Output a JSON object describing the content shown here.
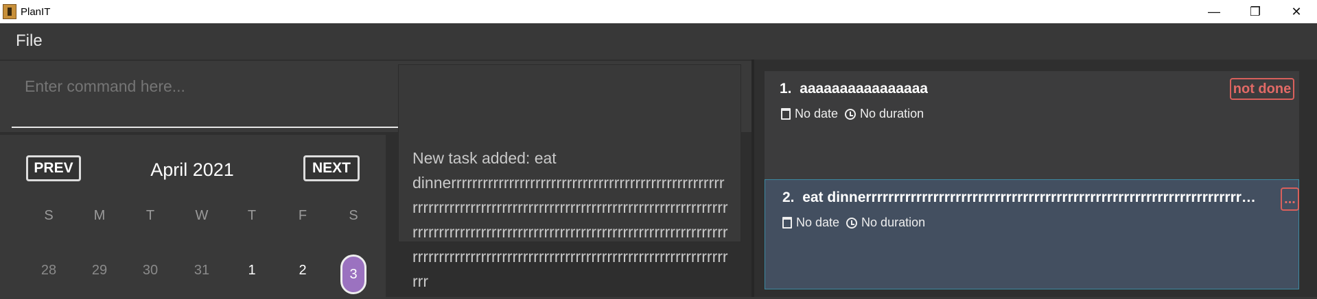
{
  "window": {
    "title": "PlanIT",
    "minimize": "—",
    "restore": "❐",
    "close": "✕"
  },
  "menu": {
    "file": "File"
  },
  "command": {
    "placeholder": "Enter command here...",
    "value": ""
  },
  "calendar": {
    "prev": "PREV",
    "next": "NEXT",
    "month": "April 2021",
    "weekdays": [
      "S",
      "M",
      "T",
      "W",
      "T",
      "F",
      "S"
    ],
    "days": [
      {
        "label": "28",
        "muted": true
      },
      {
        "label": "29",
        "muted": true
      },
      {
        "label": "30",
        "muted": true
      },
      {
        "label": "31",
        "muted": true
      },
      {
        "label": "1",
        "muted": false
      },
      {
        "label": "2",
        "muted": false
      },
      {
        "label": "3",
        "selected": true
      }
    ],
    "highlight_color": "#9b72c0"
  },
  "result": {
    "message": "New task added: eat dinnerrrrrrrrrrrrrrrrrrrrrrrrrrrrrrrrrrrrrrrrrrrrrrrrrrrrrrrrrrrrrrrrrrrrrrrrrrrrrrrrrrrrrrrrrrrrrrrrrrrrrrrrrrrrrrrrrrrrrrrrrrrrrrrrrrrrrrrrrrrrrrrrrrrrrrrrrrrrrrrrrrrrrrrrrrrrrrrrrrrrrrrrrrrrrrrrrrrrrrrrrrrrrrrrrrrrrrrrrrrrrrrrrrrrrrrrrrr"
  },
  "tasks": [
    {
      "index": "1.",
      "title": "aaaaaaaaaaaaaaaa",
      "date": "No date",
      "duration": "No duration",
      "status": "not done"
    },
    {
      "index": "2.",
      "title": "eat dinnerrrrrrrrrrrrrrrrrrrrrrrrrrrrrrrrrrrrrrrrrrrrrrrrrrrrrrrrrrrrrrrrrrrrrrrrrrrrrrrrrrrrrrrrrrrrrrrr",
      "date": "No date",
      "duration": "No duration",
      "status": "..."
    }
  ],
  "colors": {
    "status": "#e26a66",
    "selected_card": "#434f60",
    "selected_border": "#3d8aa3"
  }
}
